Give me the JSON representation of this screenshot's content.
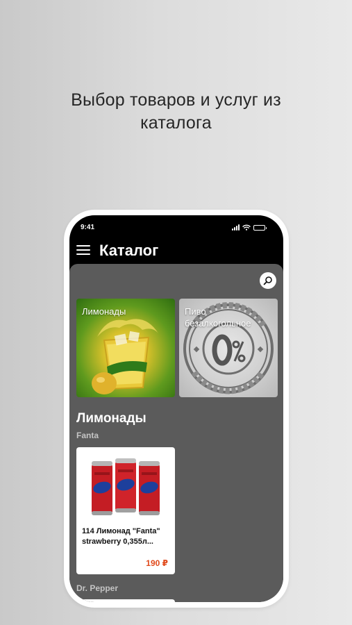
{
  "caption": {
    "line1": "Выбор товаров и услуг из",
    "line2": "каталога"
  },
  "statusbar": {
    "time": "9:41"
  },
  "header": {
    "title": "Каталог",
    "menu_icon": "hamburger-menu-icon",
    "search_icon": "search-icon"
  },
  "categories": [
    {
      "label": "Лимонады",
      "image": "lemonade-glass-image"
    },
    {
      "label": "Пиво безалкогольное",
      "image": "non-alcoholic-0-percent-stamp-image"
    }
  ],
  "section": {
    "title": "Лимонады",
    "subcategories": [
      "Fanta",
      "Dr. Pepper"
    ]
  },
  "products": [
    {
      "name": "114 Лимонад \"Fanta\" strawberry 0,355л...",
      "price": "190 ₽",
      "image": "fanta-cans-image"
    }
  ],
  "colors": {
    "accent_price": "#e04a1c",
    "content_bg": "#5b5b5b",
    "appbar_bg": "#000000"
  }
}
